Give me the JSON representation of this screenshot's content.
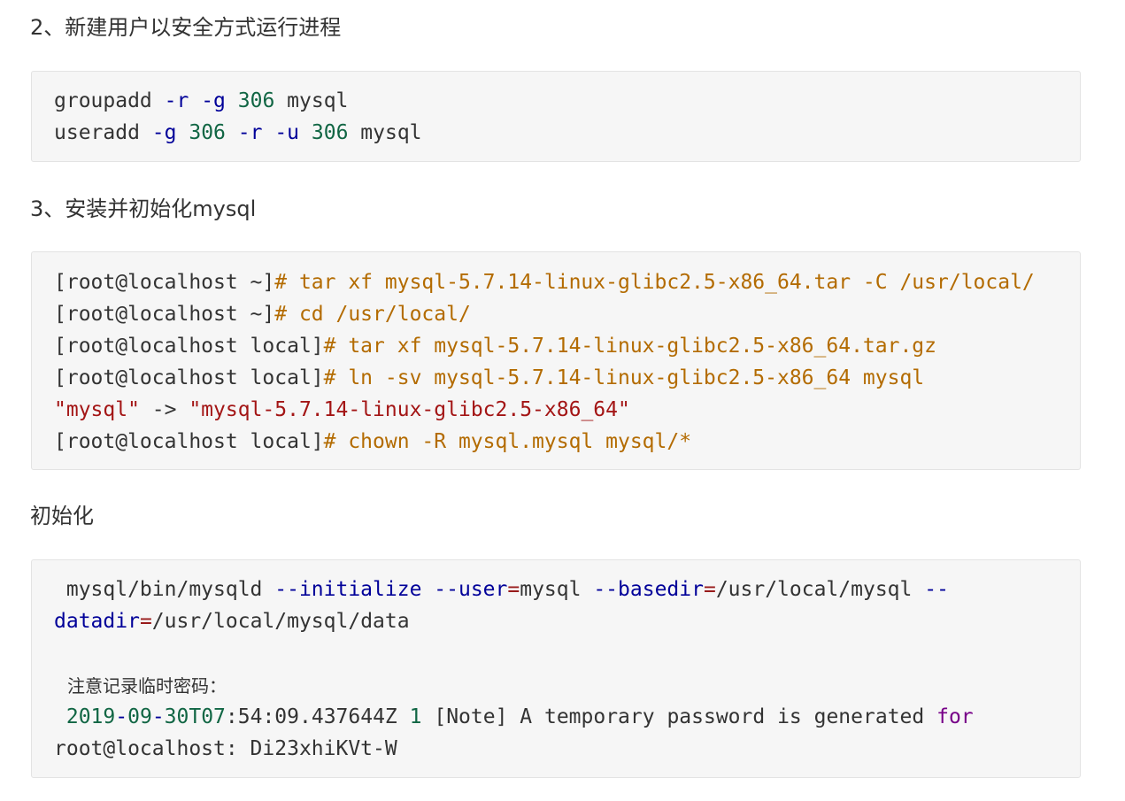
{
  "headings": {
    "step2": "2、新建用户以安全方式运行进程",
    "step3": "3、安装并初始化mysql",
    "init": "初始化"
  },
  "block1": {
    "line1": [
      "groupadd",
      " ",
      "-r",
      " ",
      "-g",
      " ",
      "306",
      " mysql"
    ],
    "line2": [
      "useradd",
      " ",
      "-g",
      " ",
      "306",
      " ",
      "-r",
      " ",
      "-u",
      " ",
      "306",
      " mysql"
    ]
  },
  "block2": {
    "line1": {
      "prompt": "[root@localhost ~]",
      "cmd": "# tar xf mysql-5.7.14-linux-glibc2.5-x86_64.tar -C /usr/local/"
    },
    "line2": {
      "prompt": "[root@localhost ~]",
      "cmd": "# cd /usr/local/"
    },
    "line3": {
      "prompt": "[root@localhost local]",
      "cmd": "# tar xf mysql-5.7.14-linux-glibc2.5-x86_64.tar.gz"
    },
    "line4": {
      "prompt": "[root@localhost local]",
      "cmd": "# ln -sv mysql-5.7.14-linux-glibc2.5-x86_64 mysql"
    },
    "line5": {
      "s1": "\"mysql\"",
      "arrow": " -> ",
      "s2": "\"mysql-5.7.14-linux-glibc2.5-x86_64\""
    },
    "line6": {
      "prompt": "[root@localhost local]",
      "cmd": "# chown -R mysql.mysql mysql/*"
    }
  },
  "block3": {
    "line1": {
      "a": " mysql/bin/mysqld ",
      "b": "--initialize",
      "c": " ",
      "d": "--user",
      "e": "=",
      "f": "mysql ",
      "g": "--basedir",
      "h": "=",
      "i": "/usr/local/mysql ",
      "j": "--"
    },
    "line2": {
      "a": "datadir",
      "b": "=",
      "c": "/usr/local/mysql/data"
    },
    "note": "注意记录临时密码：",
    "line4": {
      "a": "2019",
      "b": "-",
      "c": "09",
      "d": "-",
      "e": "30T07",
      "f": ":54:09.437644Z ",
      "g": "1",
      "h": " [Note] A temporary password is generated ",
      "i": "for"
    },
    "line5": "root@localhost: Di23xhiKVt-W"
  },
  "colors": {
    "keyword": "#000099",
    "number": "#116644",
    "command": "#b36b00",
    "string": "#a31515",
    "purple": "#770088",
    "code_background": "#f6f6f6"
  }
}
